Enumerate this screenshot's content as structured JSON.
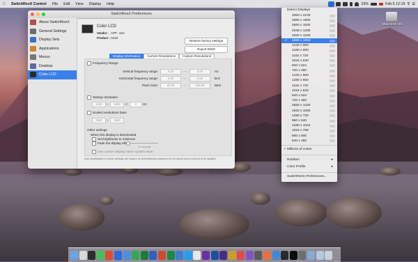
{
  "menubar": {
    "app_name": "SwitchResX Control",
    "items": [
      "File",
      "Edit",
      "View",
      "Display",
      "Help"
    ],
    "status": {
      "battery": "23%",
      "clock": "Feb 5  12:19"
    }
  },
  "window": {
    "title": "SwitchResX Preferences",
    "sidebar": [
      {
        "label": "About SwitchResX",
        "color": "#b94b4b"
      },
      {
        "label": "General Settings",
        "color": "#6e6e6e"
      },
      {
        "label": "Display Sets",
        "color": "#3d6fc0"
      },
      {
        "label": "Applications",
        "color": "#d1842a"
      },
      {
        "label": "Menus",
        "color": "#777777"
      },
      {
        "label": "Desktop",
        "color": "#5b6aa8"
      },
      {
        "label": "Color LCD",
        "color": "#2b2b2b",
        "selected": true
      }
    ],
    "display": {
      "name": "Color LCD",
      "vendor_label": "Vendor :",
      "vendor": "APP - 610",
      "product_label": "Product :",
      "product": "A018"
    },
    "buttons": {
      "restore": "Restore factory settings",
      "export": "Export EDID"
    },
    "tabs": [
      "Display Information",
      "Current Resolutions",
      "Custom Resolutions"
    ],
    "freq": {
      "title": "Frequency Range",
      "vertical_label": "Vertical frequency range:",
      "vertical_min": "0.00",
      "vertical_max": "0.00",
      "vertical_unit": "Hz",
      "horizontal_label": "Horizontal frequency range:",
      "horizontal_min": "0.00",
      "horizontal_max": "0.00",
      "horizontal_unit": "kHz",
      "pixel_label": "Pixel clock:",
      "pixel_min": "20.00",
      "pixel_max": "349.00",
      "pixel_unit": "MHz"
    },
    "startup": {
      "title": "Startup resolution",
      "w": "1440",
      "h": "1080",
      "rate": "0",
      "unit": "Hz"
    },
    "scaled": {
      "title": "Scaled resolutions base",
      "w": "2560",
      "h": "1600"
    },
    "other": {
      "title": "Other settings",
      "deactivated": "When this display is deactivated",
      "brightness": "Set brightness to minimum",
      "fade": "Fade the display after",
      "seconds": "10 seconds",
      "color_table": "Use custom display name system-wide"
    },
    "footer": "Any modification to these settings will require an Administrator password to be saved and to reboot to be applied."
  },
  "menu": {
    "header": "Detect Displays",
    "resolutions": [
      "3360 x 2100",
      "2880 x 1800",
      "2560 x 1600",
      "2048 x 1280",
      "1920 x 1200",
      "1680 x 1050",
      "1440 x 900",
      "1280 x 800",
      "1152 x 720",
      "1024 x 640",
      "840 x 524",
      "720 x 450",
      "1440 x 900",
      "1280 x 800",
      "1152 x 720",
      "1024 x 640",
      "840 x 524",
      "720 x 450",
      "2560 x 1440",
      "1920 x 1080",
      "1280 x 720",
      "960 x 540",
      "1280 x 1024",
      "1024 x 768",
      "800 x 600",
      "640 x 480"
    ],
    "selected_index": 5,
    "items": [
      {
        "label": "Millions of colors",
        "checked": true
      },
      {
        "label": "Rotation",
        "submenu": true
      },
      {
        "label": "Color Profile",
        "submenu": true
      },
      {
        "label": "SwitchResX Preferences..."
      }
    ]
  },
  "desktop": {
    "hd_label": "Macintosh HD"
  },
  "dock": {
    "colors": [
      "#6aa4e8",
      "#d9d9d9",
      "#2d2d2d",
      "#3ec35a",
      "#e2492f",
      "#2b6be0",
      "#4f8de0",
      "#34a853",
      "#1e7a3b",
      "#2f5fbf",
      "#d04a2a",
      "#188a44",
      "#3b7ed6",
      "#1da1f2",
      "#e8e8e8",
      "#6d2fa6",
      "#1b4fa0",
      "#4b2a80",
      "#c6a228",
      "#e04b4b",
      "#7e57c2",
      "#5a5a5a",
      "#e8713a",
      "#3d88d8",
      "#2a2a2a",
      "#0c0c0c",
      "#6e6e6e",
      "#8aa9d0",
      "#b5c8e0",
      "#c8d2dc"
    ]
  }
}
